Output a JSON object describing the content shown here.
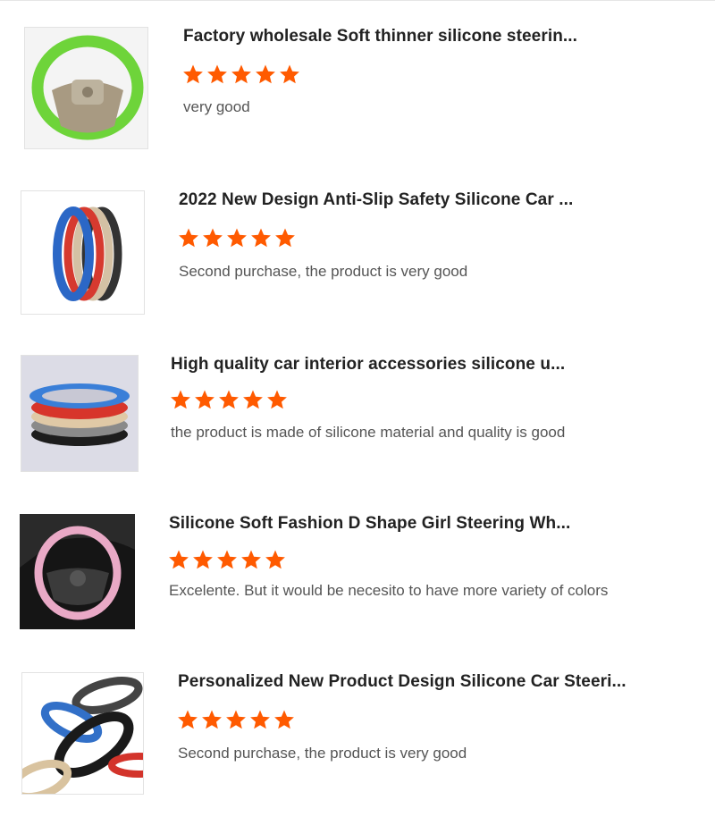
{
  "colors": {
    "star": "#ff5a00",
    "title": "#222222",
    "comment": "#555555"
  },
  "reviews": [
    {
      "title": "Factory wholesale Soft thinner silicone steerin...",
      "rating": 5,
      "comment": "very good",
      "image_icon": "green-steering-wheel-cover-image"
    },
    {
      "title": "2022 New Design Anti-Slip Safety Silicone Car ...",
      "rating": 5,
      "comment": "Second purchase, the product is very good",
      "image_icon": "multicolor-steering-covers-image"
    },
    {
      "title": "High quality car interior accessories silicone u...",
      "rating": 5,
      "comment": "the product is made of silicone material and quality is good",
      "image_icon": "stacked-steering-covers-image"
    },
    {
      "title": "Silicone Soft Fashion D Shape Girl Steering Wh...",
      "rating": 5,
      "comment": "Excelente. But it would be necesito to have more variety of colors",
      "image_icon": "pink-steering-cover-image"
    },
    {
      "title": "Personalized New Product Design Silicone Car Steeri...",
      "rating": 5,
      "comment": "Second purchase, the product is very good",
      "image_icon": "assorted-steering-covers-image"
    }
  ]
}
